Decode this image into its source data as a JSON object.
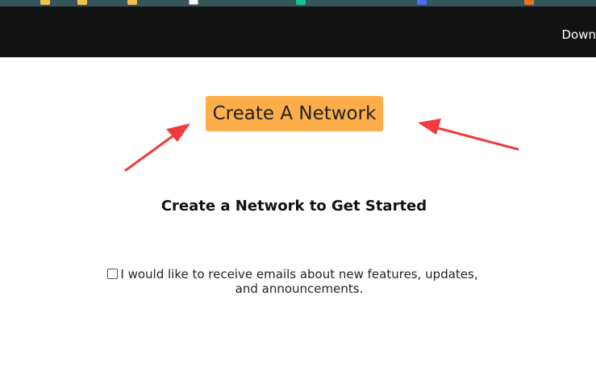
{
  "bookmarks": [
    {
      "label": "",
      "icon": "folder-icon"
    },
    {
      "label": "",
      "icon": "folder-icon"
    },
    {
      "label": "",
      "icon": "folder-icon"
    },
    {
      "label": "",
      "icon": "page-icon"
    },
    {
      "label": "",
      "icon": "green-app-icon"
    },
    {
      "label": "",
      "icon": "blue-app-icon"
    },
    {
      "label": "",
      "icon": "orange-app-icon"
    }
  ],
  "nav": {
    "download_label": "Down"
  },
  "main": {
    "create_button_label": "Create A Network",
    "heading": "Create a Network to Get Started",
    "consent_label": "I would like to receive emails about new features, updates, and announcements.",
    "consent_checked": false
  },
  "colors": {
    "bookmarks_bg": "#35575b",
    "nav_bg": "#121212",
    "button_bg": "#fdae4b",
    "annotation_arrow": "#ef3b3b"
  }
}
